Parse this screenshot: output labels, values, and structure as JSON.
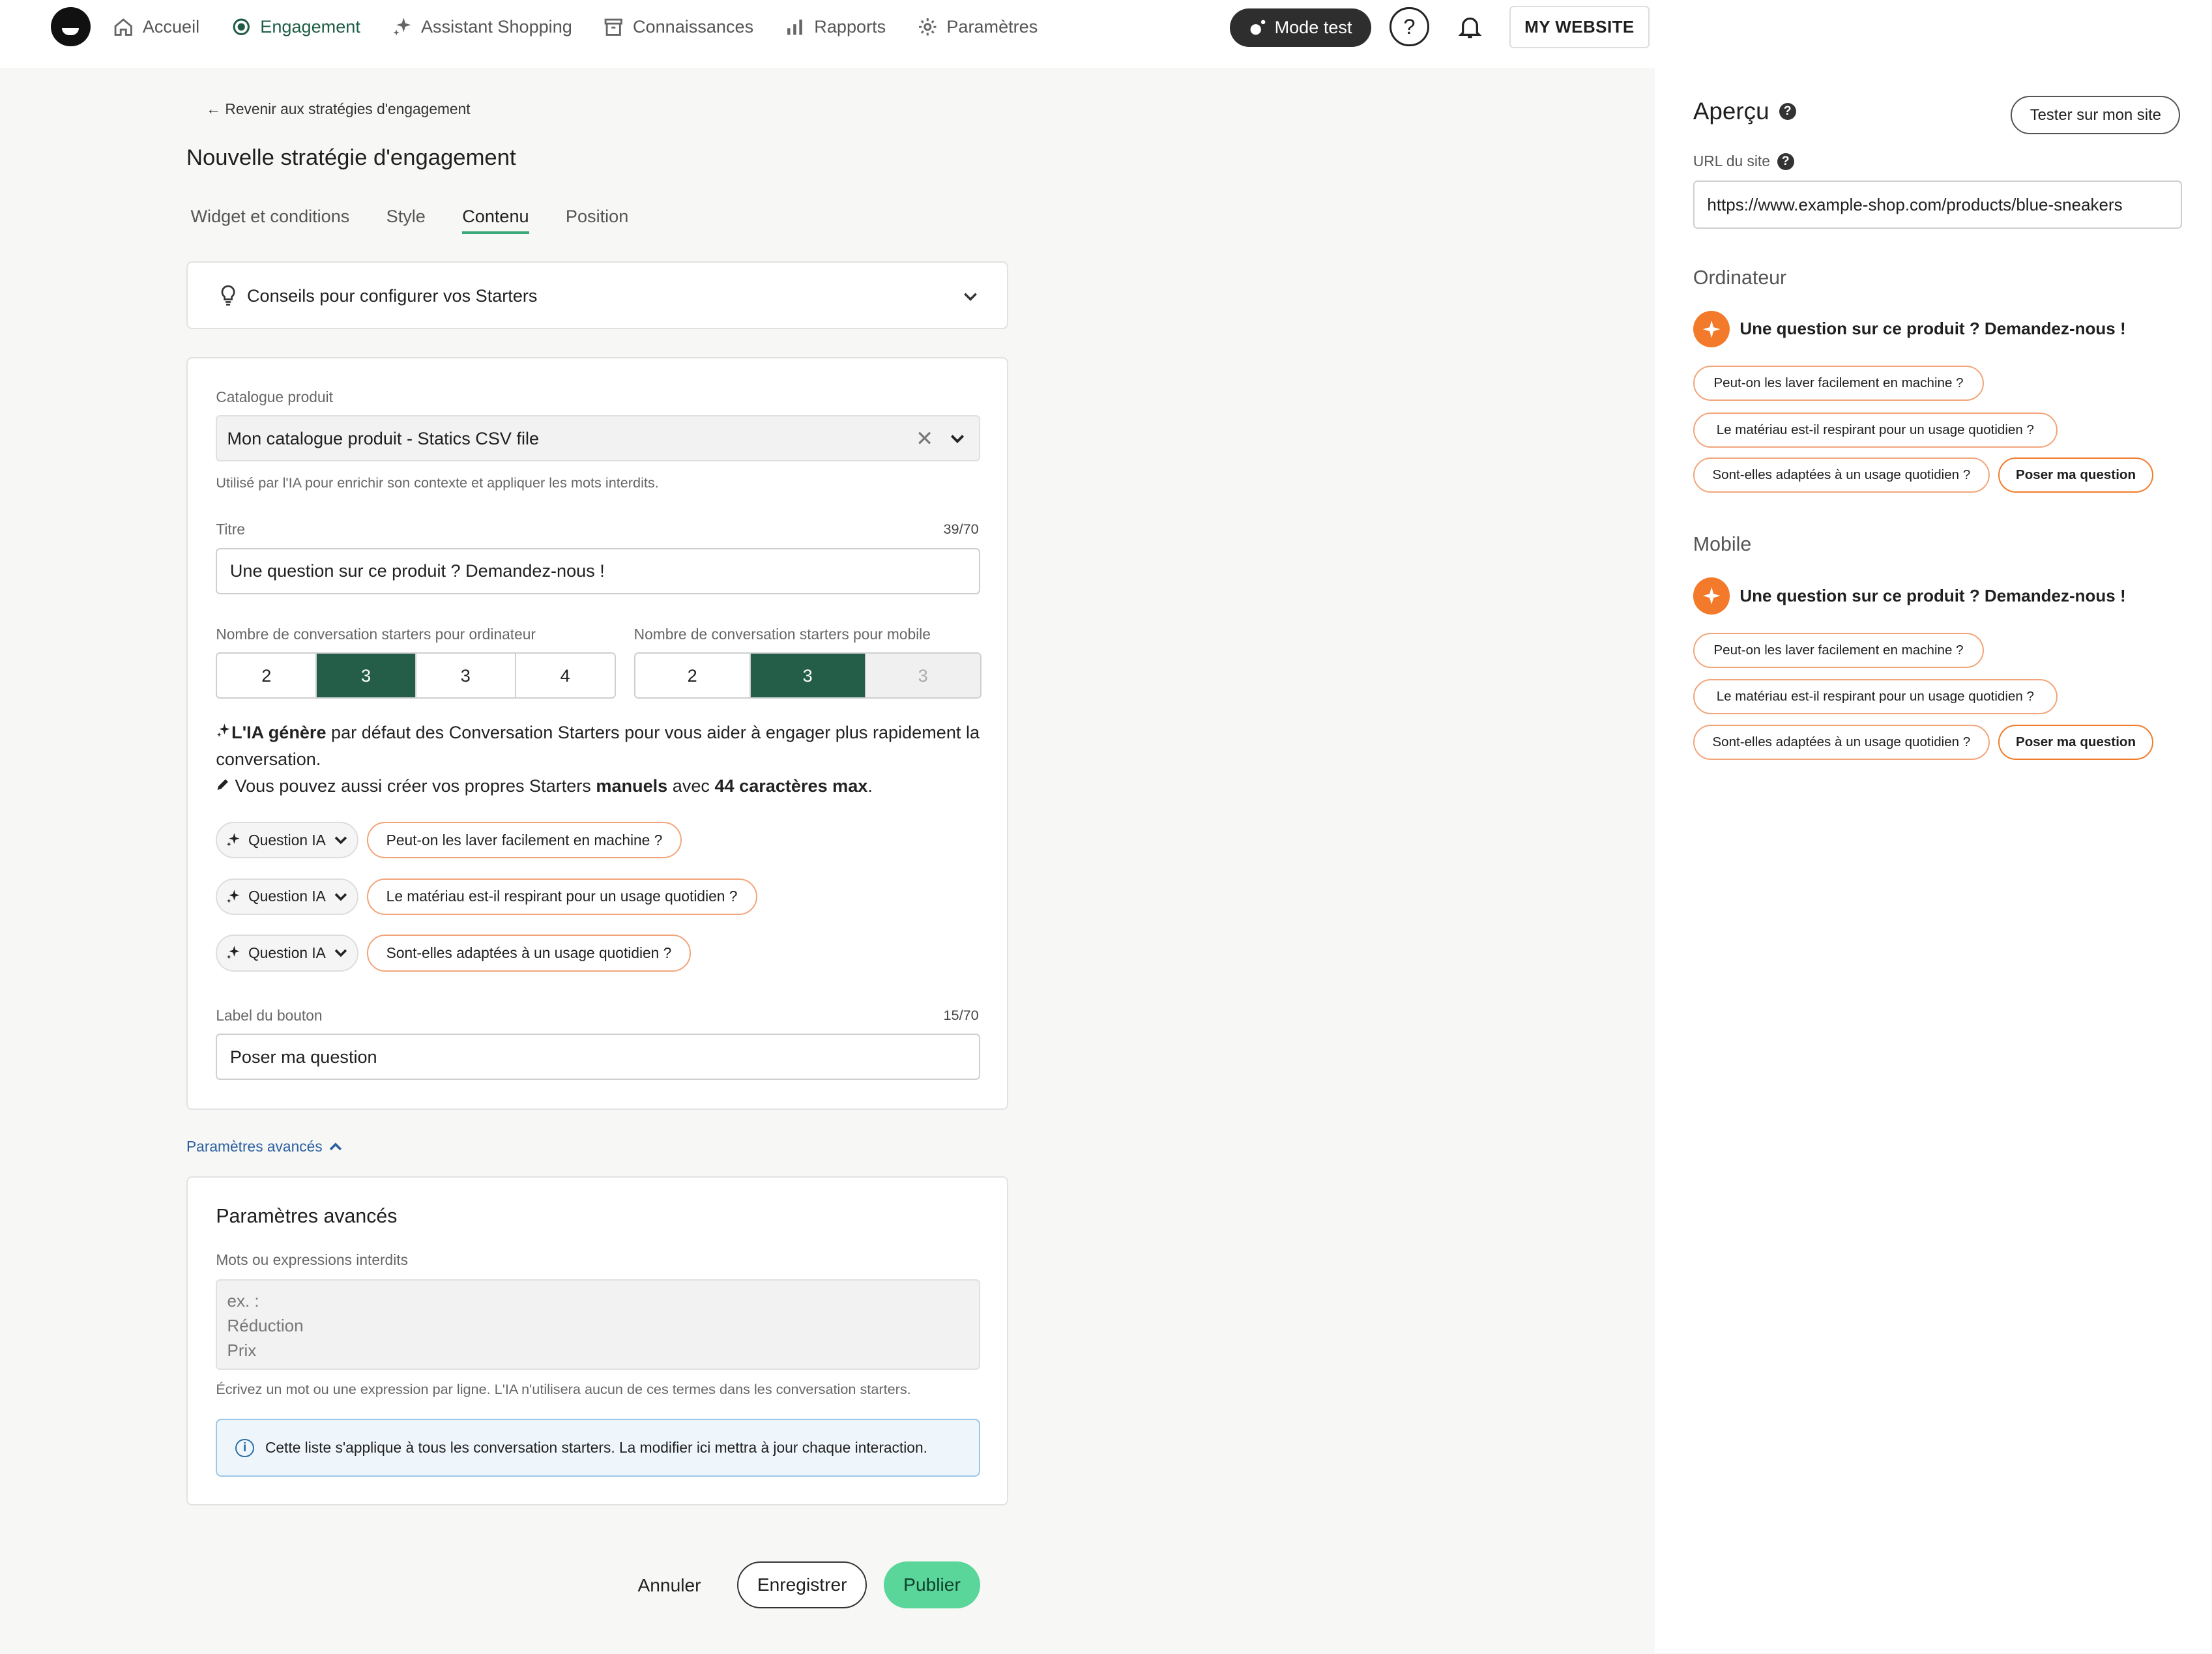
{
  "nav": {
    "items": [
      {
        "label": "Accueil",
        "icon": "home-icon"
      },
      {
        "label": "Engagement",
        "icon": "target-icon"
      },
      {
        "label": "Assistant Shopping",
        "icon": "sparkle-icon"
      },
      {
        "label": "Connaissances",
        "icon": "archive-icon"
      },
      {
        "label": "Rapports",
        "icon": "bar-chart-icon"
      },
      {
        "label": "Paramètres",
        "icon": "gear-icon"
      }
    ],
    "active": "Engagement",
    "mode_test": "Mode test",
    "help": "?",
    "website": "MY WEBSITE"
  },
  "main": {
    "back_link": "← Revenir aux stratégies d'engagement",
    "title": "Nouvelle stratégie d'engagement",
    "tabs": [
      "Widget et conditions",
      "Style",
      "Contenu",
      "Position"
    ],
    "active_tab": "Contenu",
    "tips": "Conseils pour configurer vos Starters",
    "catalog": {
      "label": "Catalogue produit",
      "value": "Mon catalogue produit - Statics CSV file",
      "clear": "✕",
      "helper": "Utilisé par l'IA pour enrichir son contexte et appliquer les mots interdits."
    },
    "titre": {
      "label": "Titre",
      "counter": "39/70",
      "value": "Une question sur ce produit ? Demandez-nous !"
    },
    "desktop_count": {
      "label": "Nombre de conversation starters pour ordinateur",
      "options": [
        "2",
        "3",
        "3",
        "4"
      ],
      "selected_index": 1
    },
    "mobile_count": {
      "label": "Nombre de conversation starters pour mobile",
      "options": [
        "2",
        "3",
        "3"
      ],
      "selected_index": 1,
      "disabled_index": 2
    },
    "info": {
      "line1_bold": "L'IA génère",
      "line1_rest": " par défaut des Conversation Starters pour vous aider à engager plus rapidement la conversation.",
      "line2_start": "Vous pouvez aussi créer vos propres Starters ",
      "line2_bold1": "manuels",
      "line2_mid": " avec ",
      "line2_bold2": "44 caractères max",
      "line2_end": "."
    },
    "questions": [
      {
        "type": "Question IA",
        "text": "Peut-on les laver facilement en machine ?"
      },
      {
        "type": "Question IA",
        "text": "Le matériau est-il respirant pour un usage quotidien ?"
      },
      {
        "type": "Question IA",
        "text": "Sont-elles adaptées à un usage quotidien ?"
      }
    ],
    "button_label": {
      "label": "Label du bouton",
      "counter": "15/70",
      "value": "Poser ma question"
    },
    "advanced_link": "Paramètres avancés",
    "advanced": {
      "title": "Paramètres avancés",
      "forbidden_label": "Mots ou expressions interdits",
      "placeholder_lines": [
        "ex. :",
        "Réduction",
        "Prix"
      ],
      "helper": "Écrivez un mot ou une expression par ligne. L'IA n'utilisera aucun de ces termes dans les conversation starters.",
      "alert": "Cette liste s'applique à tous les conversation starters. La modifier ici mettra à jour chaque interaction."
    },
    "actions": {
      "cancel": "Annuler",
      "save": "Enregistrer",
      "publish": "Publier"
    }
  },
  "preview": {
    "title": "Aperçu",
    "test_button": "Tester sur mon site",
    "url_label": "URL du site",
    "url_value": "https://www.example-shop.com/products/blue-sneakers",
    "desktop": {
      "label": "Ordinateur",
      "title": "Une question sur ce produit ? Demandez-nous !",
      "chips": [
        "Peut-on les laver facilement en machine ?",
        "Le matériau est-il respirant pour un usage quotidien ?",
        "Sont-elles adaptées à un usage quotidien ?"
      ],
      "button": "Poser ma question"
    },
    "mobile": {
      "label": "Mobile",
      "title": "Une question sur ce produit ? Demandez-nous !",
      "chips": [
        "Peut-on les laver facilement en machine ?",
        "Le matériau est-il respirant pour un usage quotidien ?",
        "Sont-elles adaptées à un usage quotidien ?"
      ],
      "button": "Poser ma question"
    }
  },
  "colors": {
    "accent_green": "#245e48",
    "publish_green": "#5ad69a",
    "orange": "#f27a2a",
    "link_blue": "#2b5fa0"
  }
}
